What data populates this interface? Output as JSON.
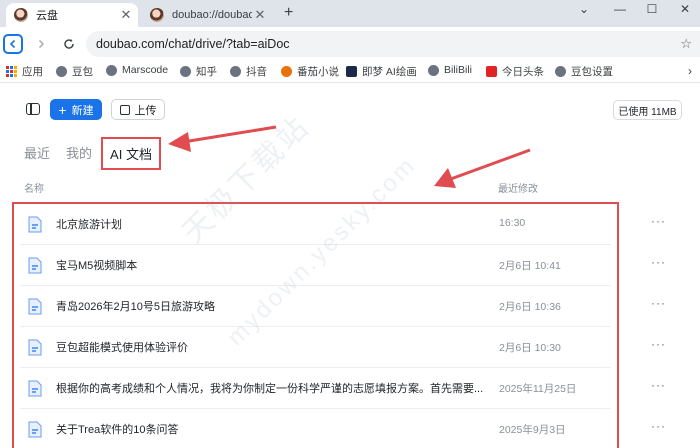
{
  "browser": {
    "tabs": [
      {
        "title": "云盘",
        "active": true
      },
      {
        "title": "doubao://doubao-setti",
        "active": false
      }
    ],
    "new_tab_icon": "plus-icon",
    "window_controls": [
      "minimize",
      "restore",
      "close"
    ],
    "address": "doubao.com/chat/drive/?tab=aiDoc",
    "bookmarks": [
      "应用",
      "豆包",
      "Marscode",
      "知乎",
      "抖音",
      "番茄小说",
      "即梦 AI绘画",
      "BiliBili",
      "今日头条",
      "豆包设置"
    ]
  },
  "drive": {
    "new_label": "新建",
    "upload_label": "上传",
    "usage": "已使用 11MB",
    "tabs": {
      "recent": "最近",
      "mine": "我的",
      "ai_docs": "AI 文档"
    },
    "columns": {
      "name": "名称",
      "modified": "最近修改"
    },
    "docs": [
      {
        "title": "北京旅游计划",
        "time": "16:30"
      },
      {
        "title": "宝马M5视频脚本",
        "time": "2月6日 10:41"
      },
      {
        "title": "青岛2026年2月10号5日旅游攻略",
        "time": "2月6日 10:36"
      },
      {
        "title": "豆包超能模式使用体验评价",
        "time": "2月6日 10:30"
      },
      {
        "title": "根据你的高考成绩和个人情况，我将为你制定一份科学严谨的志愿填报方案。首先需要...",
        "time": "2025年11月25日"
      },
      {
        "title": "关于Trea软件的10条问答",
        "time": "2025年9月3日"
      }
    ],
    "more_label": "···"
  },
  "watermark": {
    "line1": "天极下载站",
    "line2": "mydown.yesky.com"
  },
  "colors": {
    "accent": "#1a73e8",
    "highlight": "#e04c4f",
    "muted": "#8a8f99"
  }
}
